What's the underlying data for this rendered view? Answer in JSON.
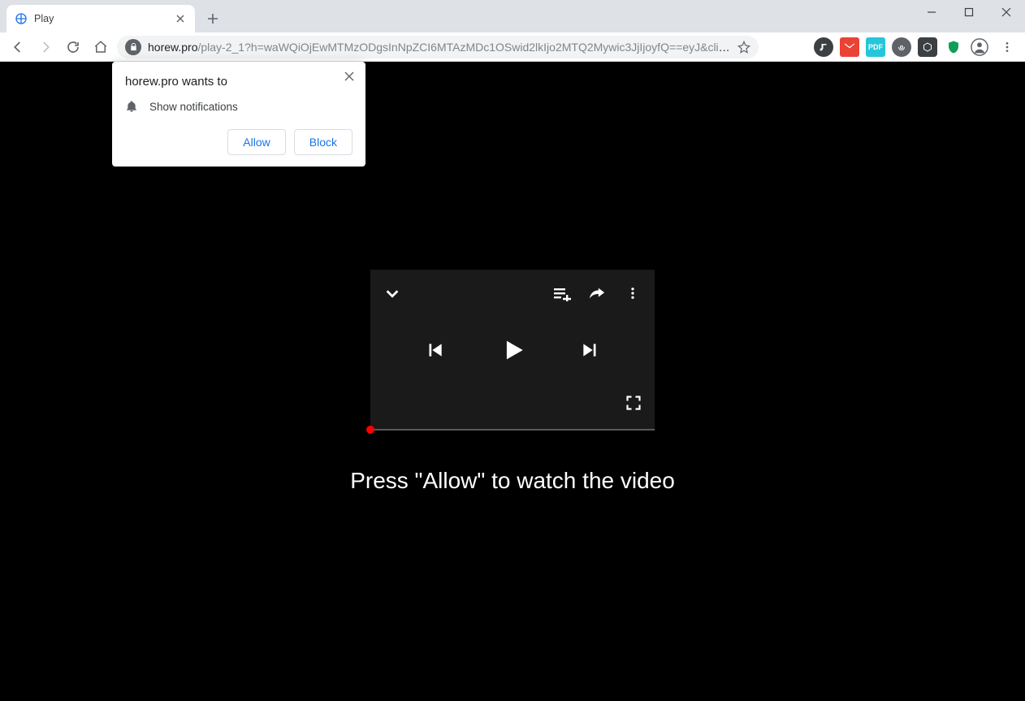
{
  "window": {
    "tab_title": "Play",
    "url_host": "horew.pro",
    "url_path": "/play-2_1?h=waWQiOjEwMTMzODgsInNpZCI6MTAzMDc1OSwid2lkIjo2MTQ2Mywic3JjIjoyfQ==eyJ&click_i..."
  },
  "permission": {
    "site": "horew.pro",
    "wants_to": "wants to",
    "request": "Show notifications",
    "allow": "Allow",
    "block": "Block"
  },
  "page": {
    "caption": "Press \"Allow\" to watch the video"
  },
  "icons": {
    "chevron_down": "chevron-down",
    "playlist_add": "playlist-add",
    "share": "share",
    "more_vert": "more-vertical",
    "skip_prev": "skip-previous",
    "play": "play",
    "skip_next": "skip-next",
    "fullscreen": "fullscreen",
    "bell": "bell"
  }
}
